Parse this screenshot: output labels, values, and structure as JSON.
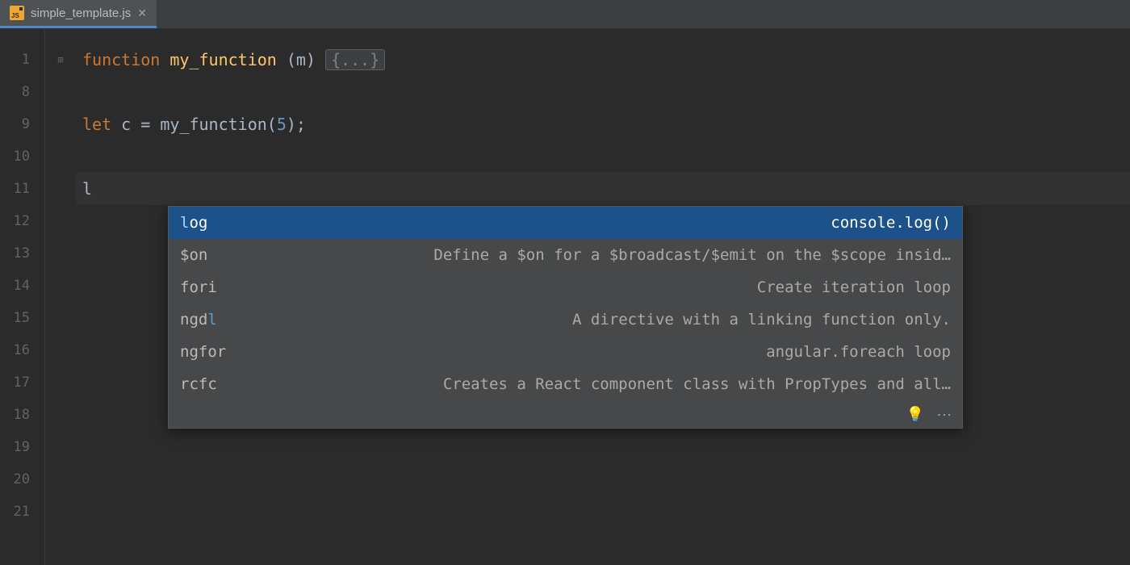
{
  "tab": {
    "icon_text": "JS",
    "filename": "simple_template.js"
  },
  "gutter": [
    "1",
    "8",
    "9",
    "10",
    "11",
    "12",
    "13",
    "14",
    "15",
    "16",
    "17",
    "18",
    "19",
    "20",
    "21"
  ],
  "code": {
    "line1": {
      "kw": "function",
      "sp": " ",
      "fn": "my_function",
      "sp2": " ",
      "paren_open": "(",
      "param": "m",
      "paren_close": ") ",
      "fold": "{...}"
    },
    "line9": {
      "kw": "let",
      "rest": " c = my_function(",
      "num": "5",
      "close": ");"
    },
    "line11_text": "l"
  },
  "autocomplete": {
    "items": [
      {
        "name_pre": "l",
        "name_post": "og",
        "desc": "console.log()",
        "selected": true
      },
      {
        "name_pre": "",
        "name_post": "$on",
        "desc": "Define a $on for a $broadcast/$emit on the $scope insid…",
        "selected": false
      },
      {
        "name_pre": "",
        "name_post": "fori",
        "desc": "Create iteration loop",
        "selected": false
      },
      {
        "name_pre": "",
        "name_post": "ngd",
        "name_hl": "l",
        "desc": "A directive with a linking function only.",
        "selected": false
      },
      {
        "name_pre": "",
        "name_post": "ngfor",
        "desc": "angular.foreach loop",
        "selected": false
      },
      {
        "name_pre": "",
        "name_post": "rcfc",
        "desc": "Creates a React component class with PropTypes and all…",
        "selected": false
      }
    ]
  }
}
